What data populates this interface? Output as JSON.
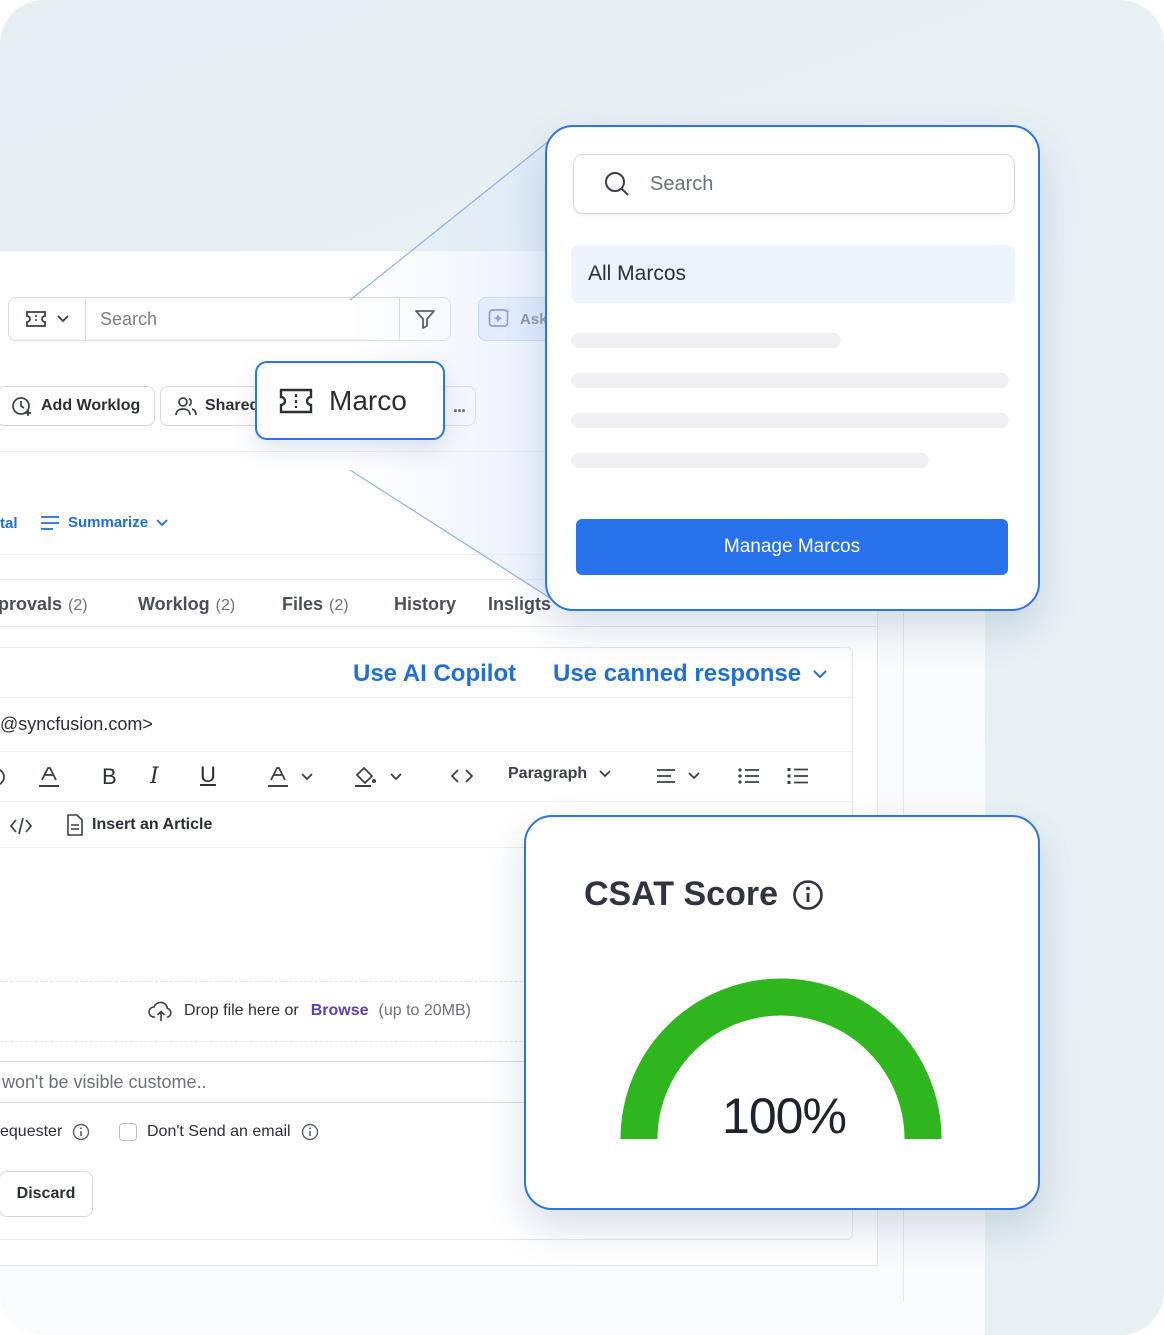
{
  "toolbar": {
    "search_placeholder": "Search",
    "ask_label": "Ask"
  },
  "actions": {
    "add_worklog": "Add Worklog",
    "shared": "Shared",
    "more": "..."
  },
  "marco_chip": {
    "label": "Marco"
  },
  "ai_row": {
    "partial_label": "tal",
    "summarize": "Summarize"
  },
  "tabs": [
    {
      "label": "provals",
      "count": "(2)"
    },
    {
      "label": "Worklog",
      "count": "(2)"
    },
    {
      "label": "Files",
      "count": "(2)"
    },
    {
      "label": "History",
      "count": ""
    },
    {
      "label": "Insligts",
      "count": ""
    }
  ],
  "editor": {
    "use_ai_copilot": "Use AI Copilot",
    "use_canned_response": "Use canned response",
    "to_address": "@syncfusion.com>",
    "paragraph": "Paragraph",
    "insert_article": "Insert an Article",
    "drop_text": "Drop file here or",
    "browse": "Browse",
    "size_limit": "(up to 20MB)",
    "note_placeholder": "won't be visible custome..",
    "requester_label": "equester",
    "dont_send_email": "Don't Send an email",
    "discard": "Discard"
  },
  "macros_popup": {
    "search_placeholder": "Search",
    "all_macros": "All Marcos",
    "manage_button": "Manage Marcos"
  },
  "csat": {
    "title": "CSAT Score",
    "value": "100%",
    "fraction": 1.0,
    "gauge_color": "#2fb51e"
  },
  "colors": {
    "accent": "#2f74e0",
    "primary_button": "#2873ec",
    "link_blue": "#1f6fd9",
    "browse_purple": "#5b3fb8"
  }
}
